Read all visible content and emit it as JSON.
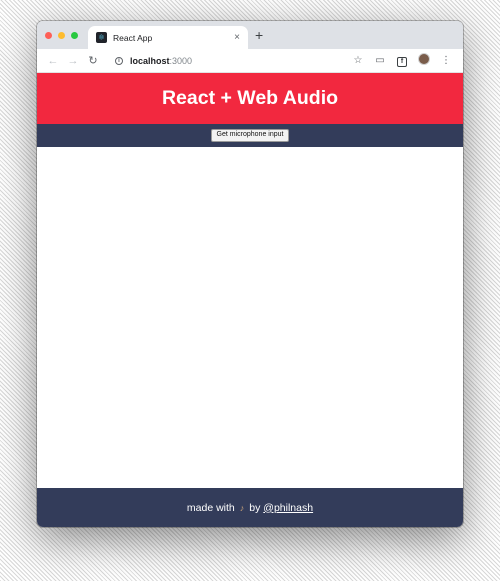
{
  "browser": {
    "tab_title": "React App",
    "tab_close_glyph": "×",
    "new_tab_glyph": "+",
    "url_host": "localhost",
    "url_port": ":3000",
    "icons": [
      "back-icon",
      "forward-icon",
      "reload-icon",
      "info-icon",
      "star-icon",
      "cast-icon",
      "extension-icon",
      "profile-icon",
      "menu-icon"
    ]
  },
  "app": {
    "title": "React + Web Audio",
    "mic_button_label": "Get microphone input",
    "footer": {
      "made_with": "made with",
      "by": "by",
      "author_link": "@philnash"
    }
  },
  "colors": {
    "header_bg": "#f2283f",
    "bar_bg": "#333c5a"
  }
}
